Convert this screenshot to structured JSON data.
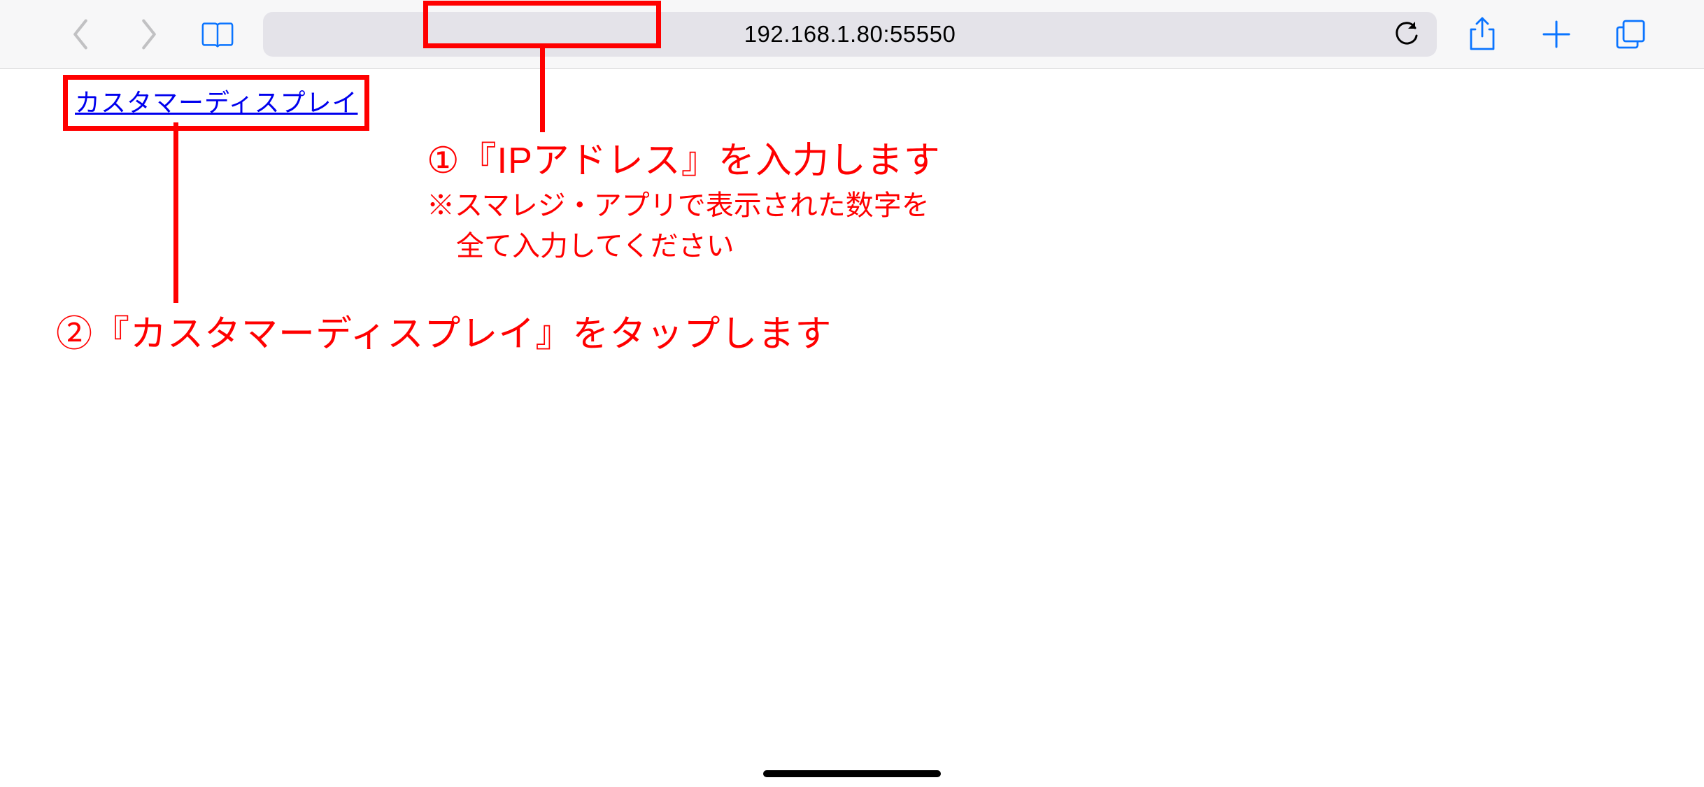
{
  "toolbar": {
    "url": "192.168.1.80:55550"
  },
  "page": {
    "link_label": "カスタマーディスプレイ"
  },
  "annotations": {
    "step1_title": "①『IPアドレス』を入力します",
    "step1_note_line1": "※スマレジ・アプリで表示された数字を",
    "step1_note_line2": "全て入力してください",
    "step2_title": "②『カスタマーディスプレイ』をタップします"
  },
  "colors": {
    "highlight": "#ff0000",
    "ios_blue": "#0a74ff",
    "disabled_gray": "#c1c1c3"
  }
}
